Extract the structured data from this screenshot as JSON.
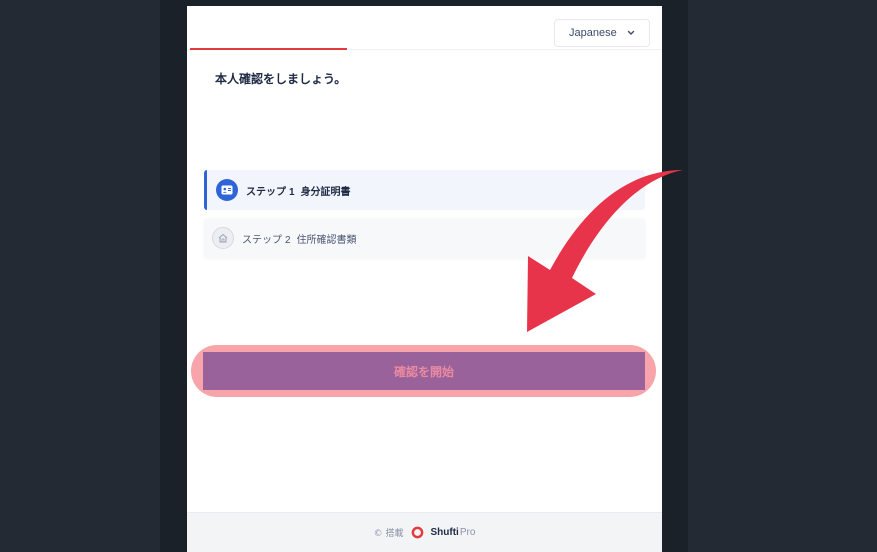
{
  "header": {
    "language": {
      "selected": "Japanese",
      "icon": "chevron-down-icon"
    }
  },
  "main": {
    "title": "本人確認をしましょう。",
    "steps": [
      {
        "prefix": "ステップ",
        "number": "1",
        "name": "身分証明書",
        "icon": "id-card-icon",
        "active": true
      },
      {
        "prefix": "ステップ",
        "number": "2",
        "name": "住所確認書類",
        "icon": "home-icon",
        "active": false
      }
    ],
    "start_button_label": "確認を開始"
  },
  "footer": {
    "powered_by": "© 搭載",
    "brand": "Shufti",
    "brand_suffix": "Pro"
  },
  "colors": {
    "accent_red": "#e23a3f",
    "step_active_blue": "#2f64d8",
    "start_button": "#99629a",
    "highlight": "#f7a5ab",
    "annotation_arrow": "#e8344a"
  },
  "annotations": {
    "arrow": "pointing-arrow-to-start-button"
  }
}
